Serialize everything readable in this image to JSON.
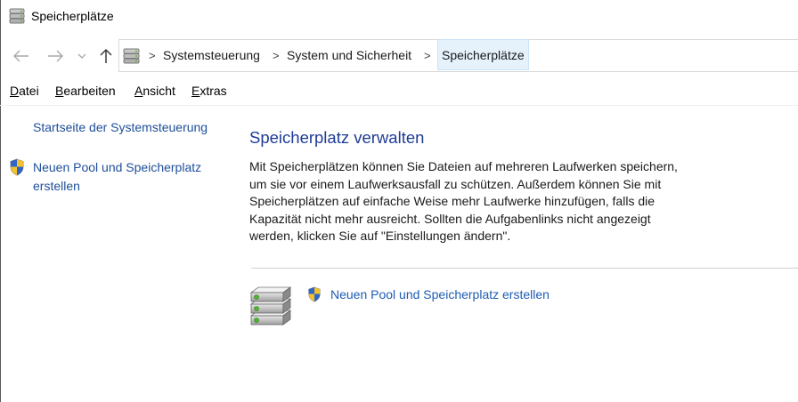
{
  "window": {
    "title": "Speicherplätze",
    "icon": "storage-spaces-icon"
  },
  "nav": {
    "back_icon": "arrow-left-icon",
    "forward_icon": "arrow-right-icon",
    "recent_icon": "chevron-down-icon",
    "up_icon": "arrow-up-icon"
  },
  "breadcrumb": {
    "separator": ">",
    "items": [
      "Systemsteuerung",
      "System und Sicherheit",
      "Speicherplätze"
    ]
  },
  "menu": {
    "items": [
      {
        "first": "D",
        "rest": "atei"
      },
      {
        "first": "B",
        "rest": "earbeiten"
      },
      {
        "first": "A",
        "rest": "nsicht"
      },
      {
        "first": "E",
        "rest": "xtras"
      }
    ]
  },
  "sidebar": {
    "home_link": "Startseite der Systemsteuerung",
    "new_pool_link": "Neuen Pool und Speicherplatz erstellen"
  },
  "main": {
    "heading": "Speicherplatz verwalten",
    "description_lines": [
      "Mit Speicherplätzen können Sie Dateien auf mehreren Laufwerken speichern,",
      "um sie vor einem Laufwerksausfall zu schützen. Außerdem können Sie mit",
      "Speicherplätzen auf einfache Weise mehr Laufwerke hinzufügen, falls die",
      "Kapazität nicht mehr ausreicht. Sollten die Aufgabenlinks nicht angezeigt",
      "werden, klicken Sie auf \"Einstellungen ändern\"."
    ],
    "task_link": "Neuen Pool und Speicherplatz erstellen"
  },
  "colors": {
    "link": "#1e5cb3",
    "heading": "#1e3c96",
    "breadcrumb_active_bg": "#e5f1fb"
  }
}
